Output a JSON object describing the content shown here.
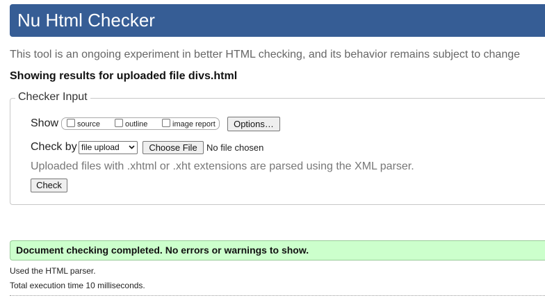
{
  "header": {
    "title": "Nu Html Checker"
  },
  "intro": {
    "text": "This tool is an ongoing experiment in better HTML checking, and its behavior remains subject to change"
  },
  "results": {
    "heading": "Showing results for uploaded file divs.html"
  },
  "checker_input": {
    "legend": "Checker Input",
    "show_label": "Show",
    "show_options": [
      {
        "label": "source",
        "checked": false
      },
      {
        "label": "outline",
        "checked": false
      },
      {
        "label": "image report",
        "checked": false
      }
    ],
    "options_button": "Options…",
    "check_by_label": "Check by",
    "check_by_selected": "file upload",
    "choose_file_button": "Choose File",
    "no_file_text": "No file chosen",
    "xml_note": "Uploaded files with .xhtml or .xht extensions are parsed using the XML parser.",
    "check_button": "Check"
  },
  "status": {
    "message": "Document checking completed. No errors or warnings to show.",
    "parser_line": "Used the HTML parser.",
    "time_line": "Total execution time 10 milliseconds."
  },
  "colors": {
    "header_bg": "#365d95",
    "success_bg": "#ccffcc"
  }
}
